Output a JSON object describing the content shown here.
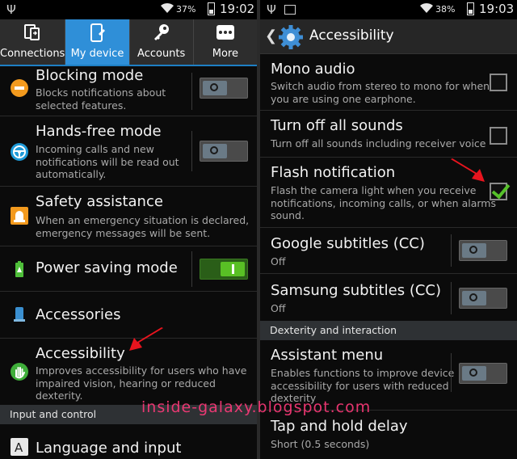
{
  "left_panel": {
    "status": {
      "battery": "37%",
      "time": "19:02"
    },
    "tabs": [
      {
        "label": "Connections",
        "icon": "connections-icon",
        "active": false
      },
      {
        "label": "My device",
        "icon": "my-device-icon",
        "active": true
      },
      {
        "label": "Accounts",
        "icon": "key-icon",
        "active": false
      },
      {
        "label": "More",
        "icon": "more-dots-icon",
        "active": false
      }
    ],
    "items": [
      {
        "title": "Blocking mode",
        "subtitle": "Blocks notifications about\nselected features.",
        "toggle": "off"
      },
      {
        "title": "Hands-free mode",
        "subtitle": "Incoming calls and new\nnotifications will be read out\nautomatically.",
        "toggle": "off"
      },
      {
        "title": "Safety assistance",
        "subtitle": "When an emergency situation is declared,\nemergency messages will be sent."
      },
      {
        "title": "Power saving mode",
        "toggle": "on"
      },
      {
        "title": "Accessories"
      },
      {
        "title": "Accessibility",
        "subtitle": "Improves accessibility for users who have\nimpaired vision, hearing or reduced\ndexterity."
      }
    ],
    "section": "Input and control",
    "bottom_item": {
      "title": "Language and input"
    }
  },
  "right_panel": {
    "status": {
      "battery": "38%",
      "time": "19:03"
    },
    "title": "Accessibility",
    "items": [
      {
        "title": "Mono audio",
        "subtitle": "Switch audio from stereo to mono for when\nyou are using one earphone.",
        "control": "checkbox",
        "checked": false
      },
      {
        "title": "Turn off all sounds",
        "subtitle": "Turn off all sounds including receiver voice",
        "control": "checkbox",
        "checked": false
      },
      {
        "title": "Flash notification",
        "subtitle": "Flash the camera light when you receive\nnotifications, incoming calls, or when alarms\nsound.",
        "control": "checkbox",
        "checked": true
      },
      {
        "title": "Google subtitles (CC)",
        "subtitle": "Off",
        "control": "toggle",
        "state": "off"
      },
      {
        "title": "Samsung subtitles (CC)",
        "subtitle": "Off",
        "control": "toggle",
        "state": "off"
      }
    ],
    "section": "Dexterity and interaction",
    "items2": [
      {
        "title": "Assistant menu",
        "subtitle": "Enables functions to improve device\naccessibility for users with reduced\ndexterity",
        "control": "toggle",
        "state": "off"
      },
      {
        "title": "Tap and hold delay",
        "subtitle": "Short (0.5 seconds)"
      }
    ]
  },
  "watermark": "inside-galaxy.blogspot.com",
  "colors": {
    "accent": "#2f8fd8",
    "toggle_on": "#59c025",
    "arrow": "#e8141e",
    "watermark": "#ff3a7a"
  }
}
